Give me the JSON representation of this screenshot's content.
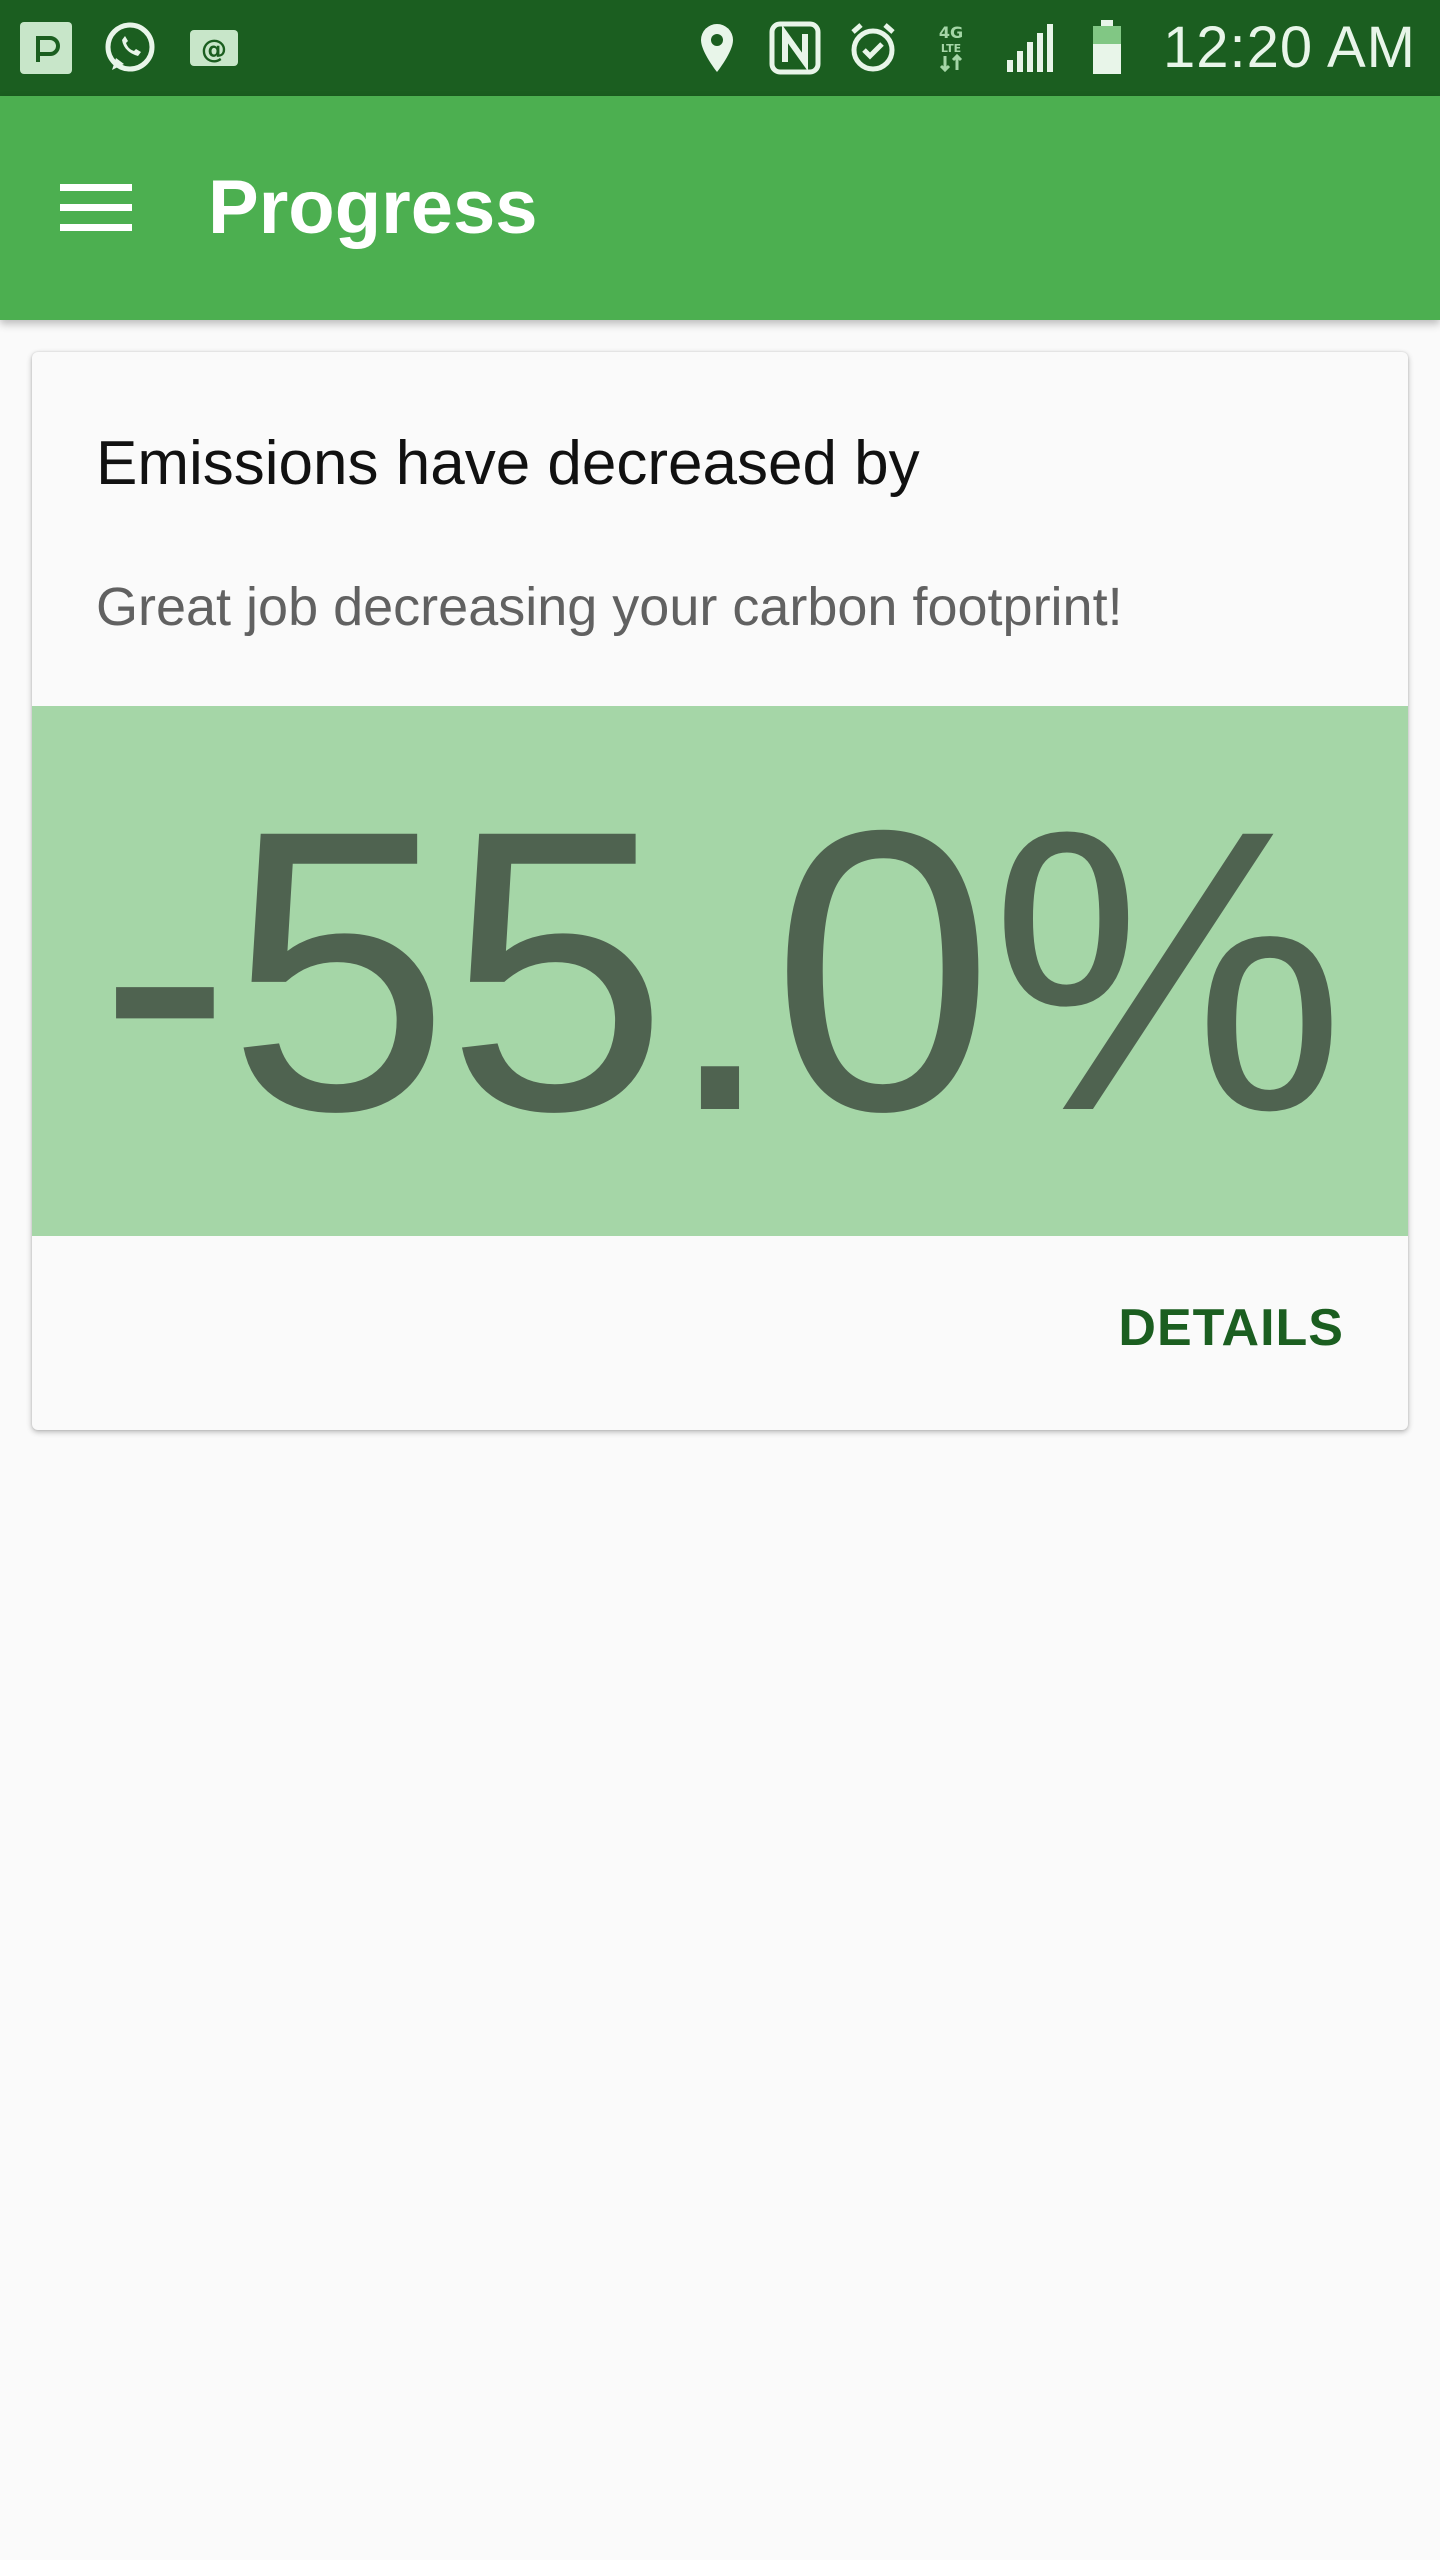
{
  "status_bar": {
    "time": "12:20 AM",
    "left_icons": [
      "pushbullet-icon",
      "whatsapp-icon",
      "email-icon"
    ],
    "right_icons": [
      "location-icon",
      "nfc-icon",
      "alarm-icon",
      "4g-lte-icon",
      "signal-icon",
      "battery-icon"
    ],
    "network_label": "4G LTE",
    "background_color": "#1b5e20"
  },
  "app_bar": {
    "title": "Progress",
    "menu_icon": "hamburger-menu-icon",
    "background_color": "#4caf50"
  },
  "card": {
    "title": "Emissions have decreased by",
    "subtitle": "Great job decreasing your carbon footprint!",
    "percent_change": "-55.0%",
    "panel_color": "#a5d6a7",
    "details_label": "DETAILS",
    "accent_color": "#1b5e20"
  }
}
